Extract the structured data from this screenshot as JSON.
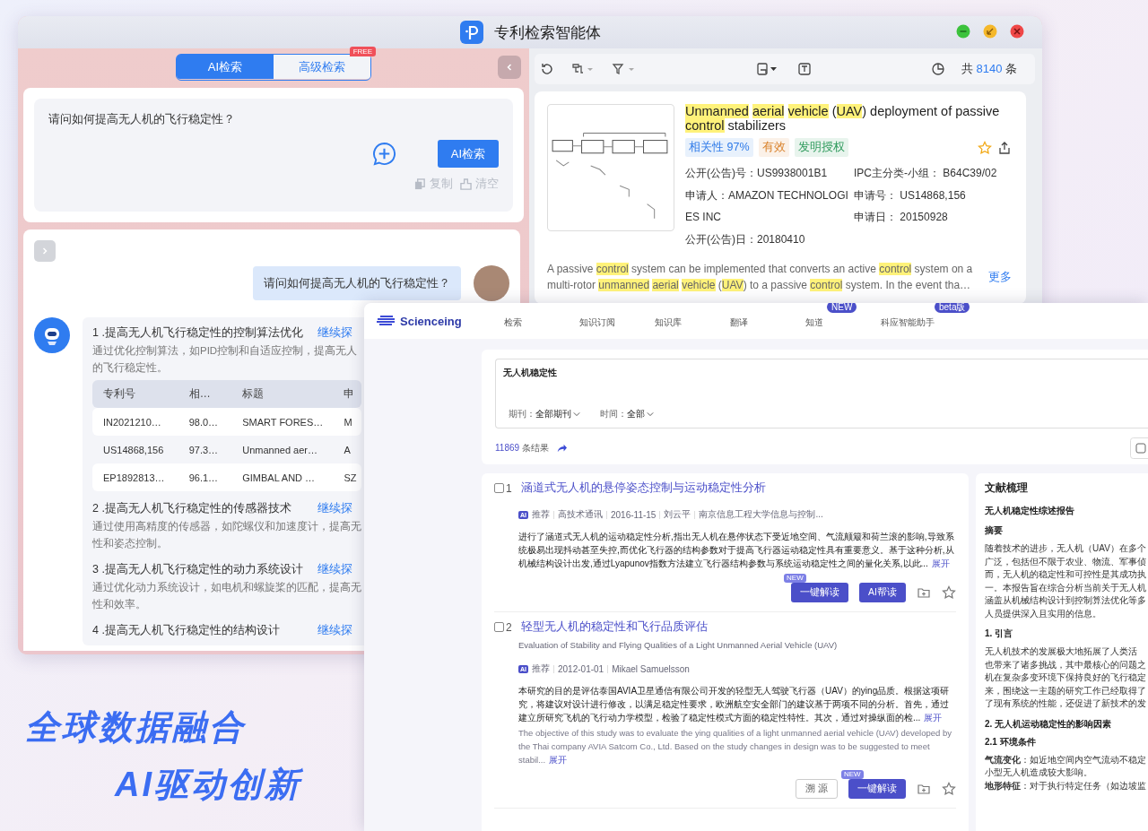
{
  "taglines": [
    "全球数据融合",
    "AI驱动创新"
  ],
  "patent_app": {
    "window": {
      "title": "专利检索智能体"
    },
    "tabs": [
      {
        "label": "AI检索",
        "selected": true
      },
      {
        "label": "高级检索",
        "selected": false,
        "badge": "FREE"
      }
    ],
    "query": {
      "value": "请问如何提高无人机的飞行稳定性？",
      "submit": "AI检索",
      "actions": [
        "复制",
        "清空"
      ]
    },
    "chat": {
      "user_message": "请问如何提高无人机的飞行稳定性？",
      "answers": [
        {
          "title": "1 .提高无人机飞行稳定性的控制算法优化",
          "link": "继续探",
          "lines": [
            "通过优化控制算法，如PID控制和自适应控制，提高无人",
            "的飞行稳定性。"
          ],
          "table": {
            "columns": [
              "专利号",
              "相…",
              "标题",
              "申"
            ],
            "rows": [
              [
                "IN2021210…",
                "98.0…",
                "SMART FORES…",
                "M"
              ],
              [
                "US14868,156",
                "97.3…",
                "Unmanned aer…",
                "A"
              ],
              [
                "EP1892813…",
                "96.1…",
                "GIMBAL AND …",
                "SZ"
              ]
            ]
          }
        },
        {
          "title": "2 .提高无人机飞行稳定性的传感器技术",
          "link": "继续探",
          "lines": [
            "通过使用高精度的传感器，如陀螺仪和加速度计，提高无",
            "性和姿态控制。"
          ]
        },
        {
          "title": "3 .提高无人机飞行稳定性的动力系统设计",
          "link": "继续探",
          "lines": [
            "通过优化动力系统设计，如电机和螺旋桨的匹配，提高无",
            "性和效率。"
          ]
        },
        {
          "title": "4 .提高无人机飞行稳定性的结构设计",
          "link": "继续探"
        }
      ]
    },
    "results": {
      "total_prefix": "共",
      "count": "8140",
      "total_suffix": "条",
      "card": {
        "title": [
          {
            "text": "Unmanned",
            "highlight": true
          },
          {
            "text": "aerial",
            "highlight": true,
            "gap": true
          },
          {
            "text": "vehicle",
            "highlight": true,
            "gap": true
          },
          {
            "text": " (",
            "highlight": false
          },
          {
            "text": "UAV",
            "highlight": true
          },
          {
            "text": ") deployment of passive ",
            "highlight": false
          },
          {
            "text": "control",
            "highlight": true
          },
          {
            "text": " stabilizers",
            "highlight": false
          }
        ],
        "tags": [
          {
            "label": "相关性 97%",
            "color": "#2f7be8"
          },
          {
            "label": "有效",
            "color": "#d9822b"
          },
          {
            "label": "发明授权",
            "color": "#2e9a5c"
          }
        ],
        "left_fields": [
          {
            "label": "公开(公告)号：",
            "value": "US9938001B1"
          },
          {
            "label": "申请人：",
            "value": "AMAZON TECHNOLOGIES INC"
          },
          {
            "label": "公开(公告)日：",
            "value": "20180410"
          }
        ],
        "right_fields": [
          {
            "label": "IPC主分类-小组：",
            "value": "B64C39/02"
          },
          {
            "label": "申请号：",
            "value": "US14868,156"
          },
          {
            "label": "申请日：",
            "value": "20150928"
          }
        ],
        "abstract": [
          {
            "text": "A passive ",
            "highlight": false
          },
          {
            "text": "control",
            "highlight": true
          },
          {
            "text": " system can be implemented that converts an active ",
            "highlight": false
          },
          {
            "text": "control",
            "highlight": true
          },
          {
            "text": " system on a multi-rotor ",
            "highlight": false
          },
          {
            "text": "unmanned",
            "highlight": true
          },
          {
            "text": "aerial",
            "highlight": true,
            "gap": true
          },
          {
            "text": "vehicle",
            "highlight": true,
            "gap": true
          },
          {
            "text": " (",
            "highlight": false
          },
          {
            "text": "UAV",
            "highlight": true
          },
          {
            "text": ") to a passive ",
            "highlight": false
          },
          {
            "text": "control",
            "highlight": true
          },
          {
            "text": " system. In the event tha…",
            "highlight": false
          }
        ],
        "more": "更多"
      }
    }
  },
  "scienceing": {
    "logo": "Scienceing",
    "nav": [
      {
        "label": "检索"
      },
      {
        "label": "知识订阅"
      },
      {
        "label": "知识库"
      },
      {
        "label": "翻译"
      },
      {
        "label": "知道",
        "badge": "NEW"
      },
      {
        "label": "科应智能助手",
        "badge": "beta版"
      }
    ],
    "search": {
      "value": "无人机稳定性",
      "filters": [
        {
          "label": "期刊：",
          "value": "全部期刊"
        },
        {
          "label": "时间：",
          "value": "全部"
        }
      ]
    },
    "result_count": "11869",
    "result_suffix": "条结果",
    "results": [
      {
        "index": "1",
        "checked": false,
        "title": "涵道式无人机的悬停姿态控制与运动稳定性分析",
        "badge": "AI",
        "meta": [
          "推荐",
          "高技术通讯",
          "2016-11-15",
          "刘云平",
          "南京信息工程大学信息与控制..."
        ],
        "abstract": "进行了涵道式无人机的运动稳定性分析,指出无人机在悬停状态下受近地空间、气流颠簸和荷兰滚的影响,导致系统极易出现抖动甚至失控,而优化飞行器的结构参数对于提高飞行器运动稳定性具有重要意义。基于这种分析,从机械结构设计出发,通过Lyapunov指数方法建立飞行器结构参数与系统运动稳定性之间的量化关系,以此...",
        "expand": "展开",
        "buttons": [
          {
            "kind": "new",
            "label": "一键解读",
            "ribbon": "NEW"
          },
          {
            "kind": "primary",
            "label": "AI帮读"
          }
        ]
      },
      {
        "index": "2",
        "checked": false,
        "title": "轻型无人机的稳定性和飞行品质评估",
        "subtitle": "Evaluation of Stability and Flying Qualities of a Light Unmanned Aerial Vehicle (UAV)",
        "badge": "AI",
        "meta": [
          "推荐",
          "2012-01-01",
          "Mikael Samuelsson"
        ],
        "abstract": "本研究的目的是评估泰国AVIA卫星通信有限公司开发的轻型无人驾驶飞行器（UAV）的ying品质。根据这项研究，将建议对设计进行修改，以满足稳定性要求，欧洲航空安全部门的建议基于两项不同的分析。首先，通过建立所研究飞机的飞行动力学模型，检验了稳定性模式方面的稳定性特性。其次，通过对操纵面的检...",
        "expand": "展开",
        "abstract_en": "The objective of this study was to evaluate the ying qualities of a light unmanned aerial vehicle (UAV) developed by the Thai company AVIA Satcom Co., Ltd. Based on the study changes in design was to be suggested to meet stabil...",
        "expand_en": "展开",
        "buttons": [
          {
            "kind": "outline",
            "label": "溯 源"
          },
          {
            "kind": "new",
            "label": "一键解读",
            "ribbon": "NEW"
          }
        ]
      }
    ],
    "review": {
      "title": "文献梳理",
      "blocks": [
        {
          "kind": "heading",
          "text": "无人机稳定性综述报告"
        },
        {
          "kind": "heading",
          "text": "摘要"
        },
        {
          "kind": "lines",
          "lines": [
            "随着技术的进步，无人机（UAV）在多个",
            "广泛，包括但不限于农业、物流、军事侦",
            "而，无人机的稳定性和可控性是其成功执",
            "一。本报告旨在综合分析当前关于无人机",
            "涵盖从机械结构设计到控制算法优化等多",
            "人员提供深入且实用的信息。"
          ]
        },
        {
          "kind": "heading",
          "text": "1. 引言"
        },
        {
          "kind": "lines",
          "lines": [
            "无人机技术的发展极大地拓展了人类活",
            "也带来了诸多挑战，其中最核心的问题之",
            "机在复杂多变环境下保持良好的飞行稳定",
            "来，围绕这一主题的研究工作已经取得了",
            "了现有系统的性能，还促进了新技术的发"
          ]
        },
        {
          "kind": "heading",
          "text": "2. 无人机运动稳定性的影响因素"
        },
        {
          "kind": "subheading",
          "text": "2.1 环境条件"
        },
        {
          "kind": "lines",
          "lines": [
            "**气流变化**：如近地空间内空气流动不稳定",
            "小型无人机造成较大影响。",
            "**地形特征**：对于执行特定任务（如边坡监"
          ]
        }
      ]
    }
  }
}
